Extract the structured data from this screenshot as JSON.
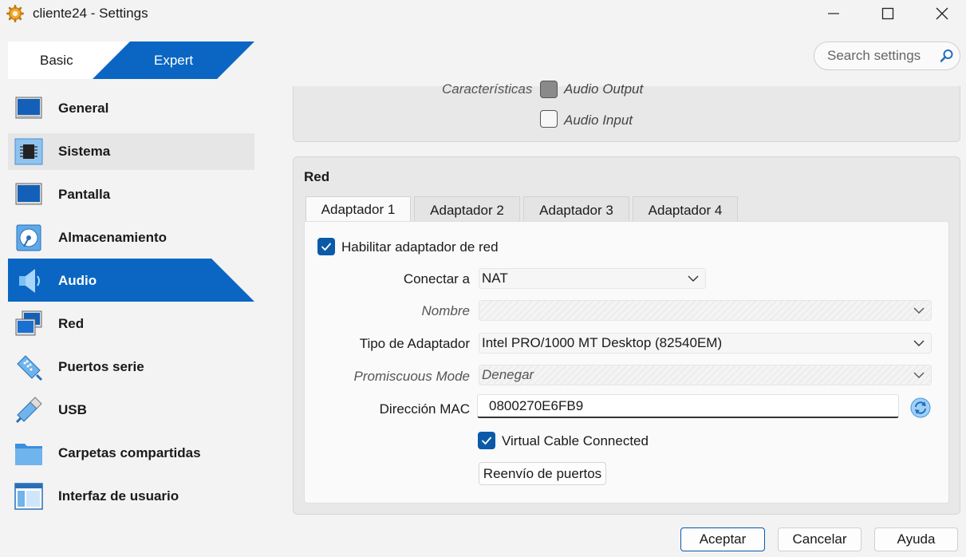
{
  "window": {
    "title": "cliente24 - Settings",
    "icon": "gear-icon"
  },
  "mode_tabs": {
    "basic": "Basic",
    "expert": "Expert"
  },
  "search": {
    "placeholder": "Search settings"
  },
  "sidebar": {
    "items": [
      {
        "label": "General",
        "icon": "monitor-icon"
      },
      {
        "label": "Sistema",
        "icon": "chip-icon"
      },
      {
        "label": "Pantalla",
        "icon": "display-icon"
      },
      {
        "label": "Almacenamiento",
        "icon": "storage-icon"
      },
      {
        "label": "Audio",
        "icon": "speaker-icon"
      },
      {
        "label": "Red",
        "icon": "network-icon"
      },
      {
        "label": "Puertos serie",
        "icon": "serial-port-icon"
      },
      {
        "label": "USB",
        "icon": "usb-icon"
      },
      {
        "label": "Carpetas compartidas",
        "icon": "folder-icon"
      },
      {
        "label": "Interfaz de usuario",
        "icon": "ui-window-icon"
      }
    ],
    "active": "Audio",
    "hovered": "Sistema"
  },
  "audio_section": {
    "features_label": "Características",
    "output_label": "Audio Output",
    "output_checked": true,
    "input_label": "Audio Input",
    "input_checked": false
  },
  "network_section": {
    "title": "Red",
    "tabs": [
      "Adaptador 1",
      "Adaptador 2",
      "Adaptador 3",
      "Adaptador 4"
    ],
    "selected_tab": "Adaptador 1",
    "enable_adapter": {
      "label": "Habilitar adaptador de red",
      "checked": true
    },
    "attached_to": {
      "label": "Conectar a",
      "value": "NAT"
    },
    "name": {
      "label": "Nombre",
      "value": ""
    },
    "adapter_type": {
      "label": "Tipo de Adaptador",
      "value": "Intel PRO/1000 MT Desktop (82540EM)"
    },
    "promiscuous": {
      "label": "Promiscuous Mode",
      "value": "Denegar"
    },
    "mac": {
      "label": "Dirección MAC",
      "value": "0800270E6FB9"
    },
    "cable_connected": {
      "label": "Virtual Cable Connected",
      "checked": true
    },
    "port_forwarding_button": "Reenvío de puertos"
  },
  "dialog_buttons": {
    "ok": "Aceptar",
    "cancel": "Cancelar",
    "help": "Ayuda"
  },
  "colors": {
    "accent": "#0a66c2",
    "checkbox": "#0a5aa8"
  }
}
